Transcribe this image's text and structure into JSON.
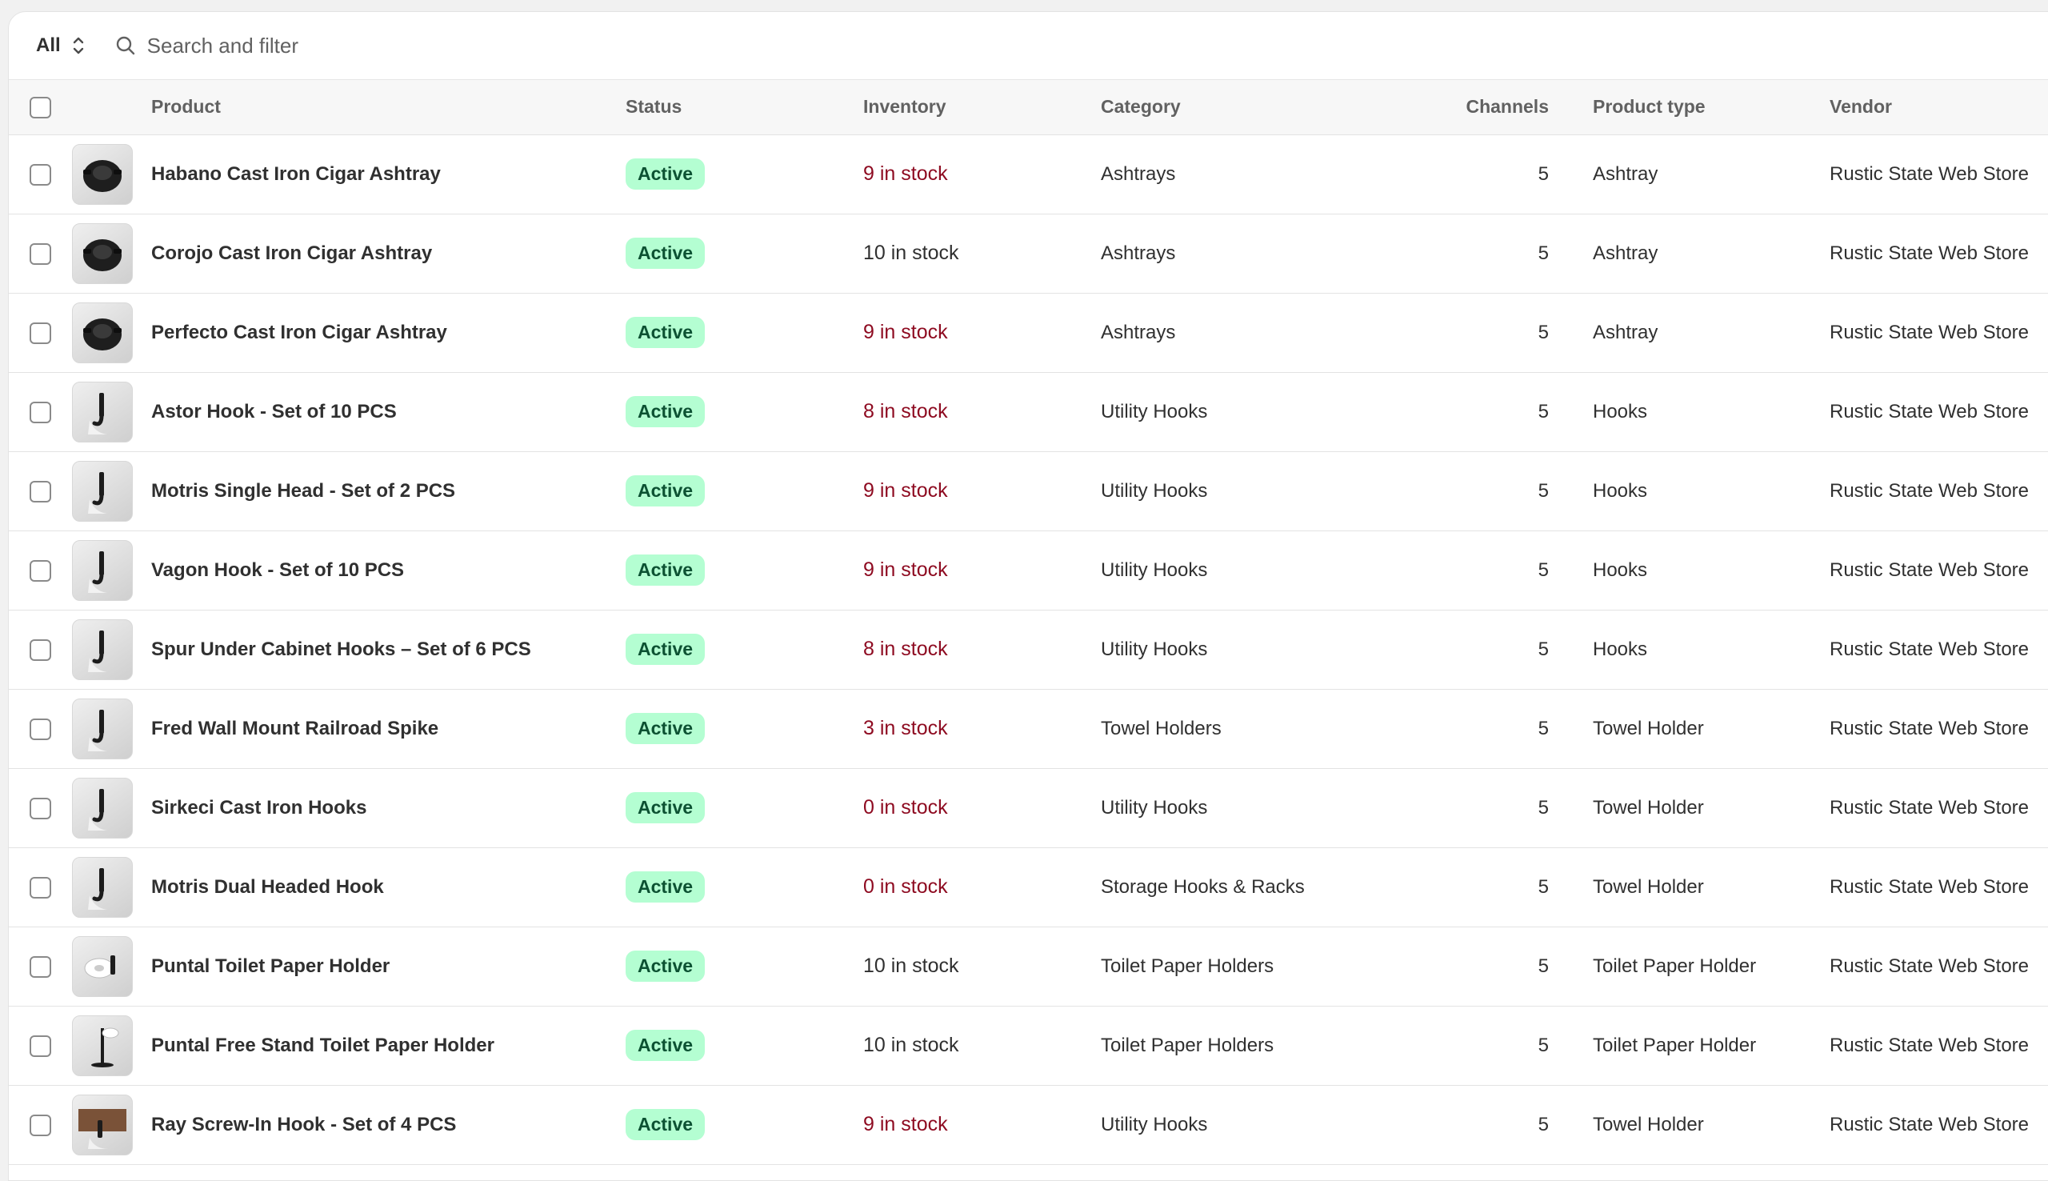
{
  "toolbar": {
    "view_label": "All",
    "search_placeholder": "Search and filter"
  },
  "columns": {
    "product": "Product",
    "status": "Status",
    "inventory": "Inventory",
    "category": "Category",
    "channels": "Channels",
    "product_type": "Product type",
    "vendor": "Vendor"
  },
  "products": [
    {
      "name": "Habano Cast Iron Cigar Ashtray",
      "status": "Active",
      "inventory": "9 in stock",
      "inv_low": true,
      "category": "Ashtrays",
      "channels": "5",
      "type": "Ashtray",
      "vendor": "Rustic State Web Store",
      "thumb": "ashtray"
    },
    {
      "name": "Corojo Cast Iron Cigar Ashtray",
      "status": "Active",
      "inventory": "10 in stock",
      "inv_low": false,
      "category": "Ashtrays",
      "channels": "5",
      "type": "Ashtray",
      "vendor": "Rustic State Web Store",
      "thumb": "ashtray"
    },
    {
      "name": "Perfecto Cast Iron Cigar Ashtray",
      "status": "Active",
      "inventory": "9 in stock",
      "inv_low": true,
      "category": "Ashtrays",
      "channels": "5",
      "type": "Ashtray",
      "vendor": "Rustic State Web Store",
      "thumb": "ashtray"
    },
    {
      "name": "Astor Hook - Set of 10 PCS",
      "status": "Active",
      "inventory": "8 in stock",
      "inv_low": true,
      "category": "Utility Hooks",
      "channels": "5",
      "type": "Hooks",
      "vendor": "Rustic State Web Store",
      "thumb": "hook"
    },
    {
      "name": "Motris Single Head - Set of 2 PCS",
      "status": "Active",
      "inventory": "9 in stock",
      "inv_low": true,
      "category": "Utility Hooks",
      "channels": "5",
      "type": "Hooks",
      "vendor": "Rustic State Web Store",
      "thumb": "hook"
    },
    {
      "name": "Vagon Hook - Set of 10 PCS",
      "status": "Active",
      "inventory": "9 in stock",
      "inv_low": true,
      "category": "Utility Hooks",
      "channels": "5",
      "type": "Hooks",
      "vendor": "Rustic State Web Store",
      "thumb": "hook"
    },
    {
      "name": "Spur Under Cabinet Hooks – Set of 6 PCS",
      "status": "Active",
      "inventory": "8 in stock",
      "inv_low": true,
      "category": "Utility Hooks",
      "channels": "5",
      "type": "Hooks",
      "vendor": "Rustic State Web Store",
      "thumb": "hook"
    },
    {
      "name": "Fred Wall Mount Railroad Spike",
      "status": "Active",
      "inventory": "3 in stock",
      "inv_low": true,
      "category": "Towel Holders",
      "channels": "5",
      "type": "Towel Holder",
      "vendor": "Rustic State Web Store",
      "thumb": "hook"
    },
    {
      "name": "Sirkeci Cast Iron Hooks",
      "status": "Active",
      "inventory": "0 in stock",
      "inv_low": true,
      "category": "Utility Hooks",
      "channels": "5",
      "type": "Towel Holder",
      "vendor": "Rustic State Web Store",
      "thumb": "hook"
    },
    {
      "name": "Motris Dual Headed Hook",
      "status": "Active",
      "inventory": "0 in stock",
      "inv_low": true,
      "category": "Storage Hooks & Racks",
      "channels": "5",
      "type": "Towel Holder",
      "vendor": "Rustic State Web Store",
      "thumb": "hook"
    },
    {
      "name": "Puntal Toilet Paper Holder",
      "status": "Active",
      "inventory": "10 in stock",
      "inv_low": false,
      "category": "Toilet Paper Holders",
      "channels": "5",
      "type": "Toilet Paper Holder",
      "vendor": "Rustic State Web Store",
      "thumb": "paper"
    },
    {
      "name": "Puntal Free Stand Toilet Paper Holder",
      "status": "Active",
      "inventory": "10 in stock",
      "inv_low": false,
      "category": "Toilet Paper Holders",
      "channels": "5",
      "type": "Toilet Paper Holder",
      "vendor": "Rustic State Web Store",
      "thumb": "stand"
    },
    {
      "name": "Ray Screw-In Hook - Set of 4 PCS",
      "status": "Active",
      "inventory": "9 in stock",
      "inv_low": true,
      "category": "Utility Hooks",
      "channels": "5",
      "type": "Towel Holder",
      "vendor": "Rustic State Web Store",
      "thumb": "wood"
    }
  ],
  "colors": {
    "active_badge_bg": "#b4fed2",
    "active_badge_text": "#0c5132",
    "low_stock_text": "#8e0b21"
  }
}
